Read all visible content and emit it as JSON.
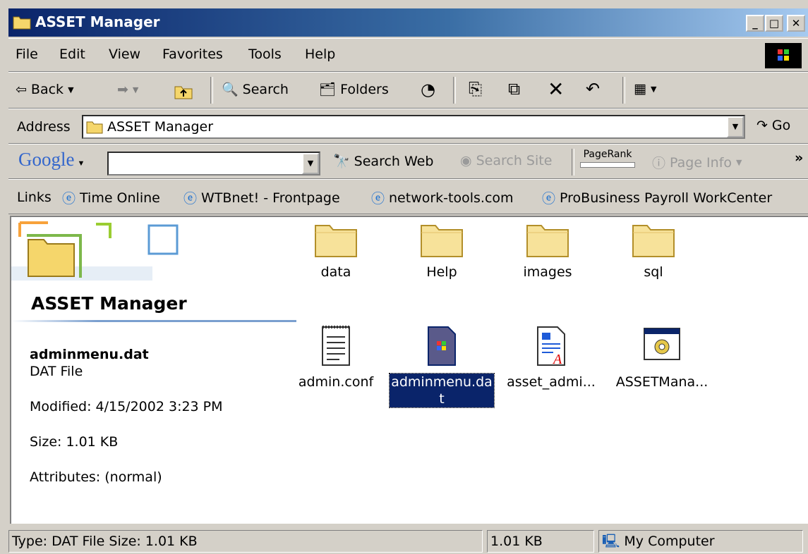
{
  "window": {
    "title": "ASSET Manager",
    "buttons": [
      "_",
      "□",
      "✕"
    ]
  },
  "menu": [
    "File",
    "Edit",
    "View",
    "Favorites",
    "Tools",
    "Help"
  ],
  "toolbar": {
    "back": "Back",
    "search": "Search",
    "folders": "Folders"
  },
  "address": {
    "label": "Address",
    "value": "ASSET Manager",
    "go": "Go"
  },
  "google": {
    "logo": "Google",
    "search_value": "",
    "search_web": "Search Web",
    "search_site": "Search Site",
    "pagerank": "PageRank",
    "page_info": "Page Info",
    "more": "»"
  },
  "links": {
    "label": "Links",
    "items": [
      "Time Online",
      "WTBnet! - Frontpage",
      "network-tools.com",
      "ProBusiness Payroll WorkCenter"
    ]
  },
  "side_panel": {
    "folder_title": "ASSET Manager",
    "file_name": "adminmenu.dat",
    "file_type": "DAT File",
    "modified": "Modified: 4/15/2002 3:23 PM",
    "size": "Size: 1.01 KB",
    "attributes": "Attributes: (normal)"
  },
  "files": {
    "folders": [
      "data",
      "Help",
      "images",
      "sql"
    ],
    "files": [
      {
        "name": "admin.conf",
        "icon": "text-file-icon"
      },
      {
        "name_line1": "adminmenu.da",
        "name_line2": "t",
        "icon": "dat-file-icon",
        "selected": true
      },
      {
        "name": "asset_admi...",
        "icon": "document-file-icon"
      },
      {
        "name": "ASSETMana...",
        "icon": "application-icon"
      }
    ]
  },
  "status": {
    "type_text": "Type: DAT File Size: 1.01 KB",
    "size": "1.01 KB",
    "zone": "My Computer"
  }
}
